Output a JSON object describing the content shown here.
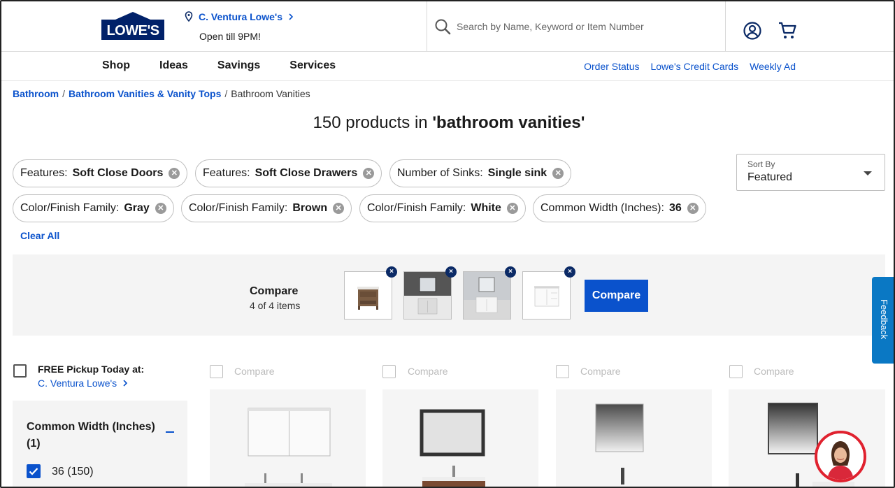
{
  "header": {
    "logo_text": "LOWE'S",
    "store_name": "C. Ventura Lowe's",
    "store_hours": "Open till 9PM!",
    "search_placeholder": "Search by Name, Keyword or Item Number",
    "icons": [
      "location-pin-icon",
      "chevron-right-icon",
      "search-icon",
      "account-icon",
      "cart-icon"
    ]
  },
  "nav": {
    "main": [
      "Shop",
      "Ideas",
      "Savings",
      "Services"
    ],
    "links": [
      "Order Status",
      "Lowe's Credit Cards",
      "Weekly Ad"
    ]
  },
  "breadcrumb": {
    "items": [
      "Bathroom",
      "Bathroom Vanities & Vanity Tops"
    ],
    "current": "Bathroom Vanities",
    "separator": "/"
  },
  "results": {
    "prefix": "150 products in ",
    "query": "'bathroom vanities'"
  },
  "filters": [
    {
      "label": "Features:",
      "value": "Soft Close Doors"
    },
    {
      "label": "Features:",
      "value": "Soft Close Drawers"
    },
    {
      "label": "Number of Sinks:",
      "value": "Single sink"
    },
    {
      "label": "Color/Finish Family:",
      "value": "Gray"
    },
    {
      "label": "Color/Finish Family:",
      "value": "Brown"
    },
    {
      "label": "Color/Finish Family:",
      "value": "White"
    },
    {
      "label": "Common Width (Inches):",
      "value": "36"
    }
  ],
  "clear_all": "Clear All",
  "sort": {
    "caption": "Sort By",
    "value": "Featured"
  },
  "compare": {
    "title": "Compare",
    "subtitle": "4 of 4 items",
    "button": "Compare",
    "remove_glyph": "×"
  },
  "feedback": "Feedback",
  "left_filter": {
    "pickup_title": "FREE Pickup Today at:",
    "pickup_store": "C. Ventura Lowe's",
    "section_title": "Common Width (Inches) (1)",
    "option_label": "36 (150)"
  },
  "products": {
    "compare_label": "Compare"
  },
  "colors": {
    "brand_blue": "#0a52cc",
    "logo_navy": "#012169",
    "feedback_blue": "#0a78c4",
    "agent_ring": "#e0222f"
  }
}
